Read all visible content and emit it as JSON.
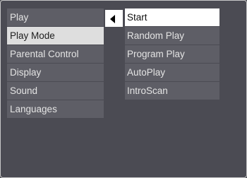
{
  "main_menu": {
    "items": [
      {
        "label": "Play",
        "selected": false
      },
      {
        "label": "Play Mode",
        "selected": true
      },
      {
        "label": "Parental Control",
        "selected": false
      },
      {
        "label": "Display",
        "selected": false
      },
      {
        "label": "Sound",
        "selected": false
      },
      {
        "label": "Languages",
        "selected": false
      }
    ]
  },
  "navigation": {
    "back_arrow_icon": "left-triangle-arrow"
  },
  "sub_menu": {
    "items": [
      {
        "label": "Start",
        "selected": true
      },
      {
        "label": "Random Play",
        "selected": false
      },
      {
        "label": "Program Play",
        "selected": false
      },
      {
        "label": "AutoPlay",
        "selected": false
      },
      {
        "label": "IntroScan",
        "selected": false
      }
    ]
  },
  "colors": {
    "background": "#4b4b53",
    "item_background": "#5e5e66",
    "item_text": "#e4e4e4",
    "selected_main_background": "#dedede",
    "selected_sub_background": "#ffffff"
  }
}
